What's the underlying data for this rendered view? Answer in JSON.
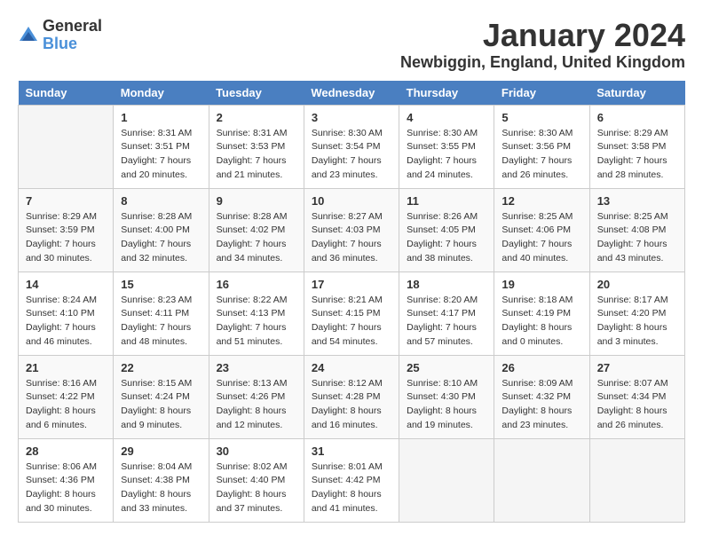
{
  "logo": {
    "general": "General",
    "blue": "Blue"
  },
  "title": "January 2024",
  "location": "Newbiggin, England, United Kingdom",
  "days_header": [
    "Sunday",
    "Monday",
    "Tuesday",
    "Wednesday",
    "Thursday",
    "Friday",
    "Saturday"
  ],
  "weeks": [
    [
      {
        "day": "",
        "info": ""
      },
      {
        "day": "1",
        "info": "Sunrise: 8:31 AM\nSunset: 3:51 PM\nDaylight: 7 hours\nand 20 minutes."
      },
      {
        "day": "2",
        "info": "Sunrise: 8:31 AM\nSunset: 3:53 PM\nDaylight: 7 hours\nand 21 minutes."
      },
      {
        "day": "3",
        "info": "Sunrise: 8:30 AM\nSunset: 3:54 PM\nDaylight: 7 hours\nand 23 minutes."
      },
      {
        "day": "4",
        "info": "Sunrise: 8:30 AM\nSunset: 3:55 PM\nDaylight: 7 hours\nand 24 minutes."
      },
      {
        "day": "5",
        "info": "Sunrise: 8:30 AM\nSunset: 3:56 PM\nDaylight: 7 hours\nand 26 minutes."
      },
      {
        "day": "6",
        "info": "Sunrise: 8:29 AM\nSunset: 3:58 PM\nDaylight: 7 hours\nand 28 minutes."
      }
    ],
    [
      {
        "day": "7",
        "info": "Sunrise: 8:29 AM\nSunset: 3:59 PM\nDaylight: 7 hours\nand 30 minutes."
      },
      {
        "day": "8",
        "info": "Sunrise: 8:28 AM\nSunset: 4:00 PM\nDaylight: 7 hours\nand 32 minutes."
      },
      {
        "day": "9",
        "info": "Sunrise: 8:28 AM\nSunset: 4:02 PM\nDaylight: 7 hours\nand 34 minutes."
      },
      {
        "day": "10",
        "info": "Sunrise: 8:27 AM\nSunset: 4:03 PM\nDaylight: 7 hours\nand 36 minutes."
      },
      {
        "day": "11",
        "info": "Sunrise: 8:26 AM\nSunset: 4:05 PM\nDaylight: 7 hours\nand 38 minutes."
      },
      {
        "day": "12",
        "info": "Sunrise: 8:25 AM\nSunset: 4:06 PM\nDaylight: 7 hours\nand 40 minutes."
      },
      {
        "day": "13",
        "info": "Sunrise: 8:25 AM\nSunset: 4:08 PM\nDaylight: 7 hours\nand 43 minutes."
      }
    ],
    [
      {
        "day": "14",
        "info": "Sunrise: 8:24 AM\nSunset: 4:10 PM\nDaylight: 7 hours\nand 46 minutes."
      },
      {
        "day": "15",
        "info": "Sunrise: 8:23 AM\nSunset: 4:11 PM\nDaylight: 7 hours\nand 48 minutes."
      },
      {
        "day": "16",
        "info": "Sunrise: 8:22 AM\nSunset: 4:13 PM\nDaylight: 7 hours\nand 51 minutes."
      },
      {
        "day": "17",
        "info": "Sunrise: 8:21 AM\nSunset: 4:15 PM\nDaylight: 7 hours\nand 54 minutes."
      },
      {
        "day": "18",
        "info": "Sunrise: 8:20 AM\nSunset: 4:17 PM\nDaylight: 7 hours\nand 57 minutes."
      },
      {
        "day": "19",
        "info": "Sunrise: 8:18 AM\nSunset: 4:19 PM\nDaylight: 8 hours\nand 0 minutes."
      },
      {
        "day": "20",
        "info": "Sunrise: 8:17 AM\nSunset: 4:20 PM\nDaylight: 8 hours\nand 3 minutes."
      }
    ],
    [
      {
        "day": "21",
        "info": "Sunrise: 8:16 AM\nSunset: 4:22 PM\nDaylight: 8 hours\nand 6 minutes."
      },
      {
        "day": "22",
        "info": "Sunrise: 8:15 AM\nSunset: 4:24 PM\nDaylight: 8 hours\nand 9 minutes."
      },
      {
        "day": "23",
        "info": "Sunrise: 8:13 AM\nSunset: 4:26 PM\nDaylight: 8 hours\nand 12 minutes."
      },
      {
        "day": "24",
        "info": "Sunrise: 8:12 AM\nSunset: 4:28 PM\nDaylight: 8 hours\nand 16 minutes."
      },
      {
        "day": "25",
        "info": "Sunrise: 8:10 AM\nSunset: 4:30 PM\nDaylight: 8 hours\nand 19 minutes."
      },
      {
        "day": "26",
        "info": "Sunrise: 8:09 AM\nSunset: 4:32 PM\nDaylight: 8 hours\nand 23 minutes."
      },
      {
        "day": "27",
        "info": "Sunrise: 8:07 AM\nSunset: 4:34 PM\nDaylight: 8 hours\nand 26 minutes."
      }
    ],
    [
      {
        "day": "28",
        "info": "Sunrise: 8:06 AM\nSunset: 4:36 PM\nDaylight: 8 hours\nand 30 minutes."
      },
      {
        "day": "29",
        "info": "Sunrise: 8:04 AM\nSunset: 4:38 PM\nDaylight: 8 hours\nand 33 minutes."
      },
      {
        "day": "30",
        "info": "Sunrise: 8:02 AM\nSunset: 4:40 PM\nDaylight: 8 hours\nand 37 minutes."
      },
      {
        "day": "31",
        "info": "Sunrise: 8:01 AM\nSunset: 4:42 PM\nDaylight: 8 hours\nand 41 minutes."
      },
      {
        "day": "",
        "info": ""
      },
      {
        "day": "",
        "info": ""
      },
      {
        "day": "",
        "info": ""
      }
    ]
  ]
}
